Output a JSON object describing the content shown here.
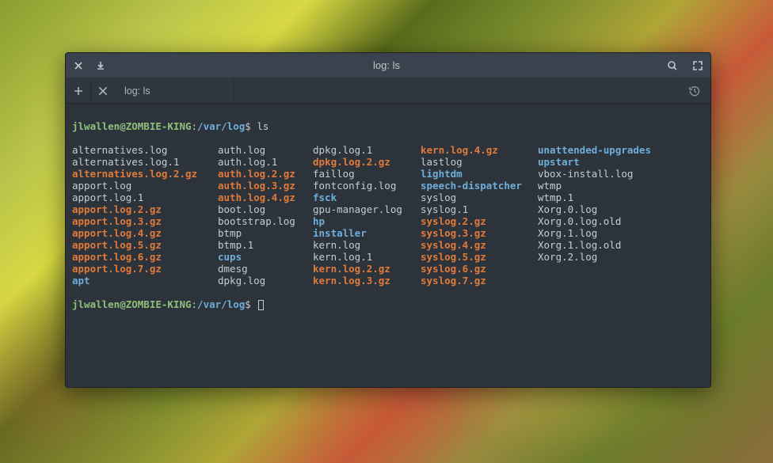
{
  "titlebar": {
    "title": "log: ls"
  },
  "tabs": [
    {
      "label": "log: ls"
    }
  ],
  "prompt": {
    "user_host": "jlwallen@ZOMBIE-KING",
    "sep": ":",
    "cwd": "/var/log",
    "dollar": "$ ",
    "command": "ls"
  },
  "file_types": {
    "plain": "regular file",
    "blue": "directory",
    "orange": "archive / compressed (.gz)"
  },
  "ls": {
    "columns": [
      [
        {
          "name": "alternatives.log",
          "type": "plain"
        },
        {
          "name": "alternatives.log.1",
          "type": "plain"
        },
        {
          "name": "alternatives.log.2.gz",
          "type": "orange"
        },
        {
          "name": "apport.log",
          "type": "plain"
        },
        {
          "name": "apport.log.1",
          "type": "plain"
        },
        {
          "name": "apport.log.2.gz",
          "type": "orange"
        },
        {
          "name": "apport.log.3.gz",
          "type": "orange"
        },
        {
          "name": "apport.log.4.gz",
          "type": "orange"
        },
        {
          "name": "apport.log.5.gz",
          "type": "orange"
        },
        {
          "name": "apport.log.6.gz",
          "type": "orange"
        },
        {
          "name": "apport.log.7.gz",
          "type": "orange"
        },
        {
          "name": "apt",
          "type": "blue"
        }
      ],
      [
        {
          "name": "auth.log",
          "type": "plain"
        },
        {
          "name": "auth.log.1",
          "type": "plain"
        },
        {
          "name": "auth.log.2.gz",
          "type": "orange"
        },
        {
          "name": "auth.log.3.gz",
          "type": "orange"
        },
        {
          "name": "auth.log.4.gz",
          "type": "orange"
        },
        {
          "name": "boot.log",
          "type": "plain"
        },
        {
          "name": "bootstrap.log",
          "type": "plain"
        },
        {
          "name": "btmp",
          "type": "plain"
        },
        {
          "name": "btmp.1",
          "type": "plain"
        },
        {
          "name": "cups",
          "type": "blue"
        },
        {
          "name": "dmesg",
          "type": "plain"
        },
        {
          "name": "dpkg.log",
          "type": "plain"
        }
      ],
      [
        {
          "name": "dpkg.log.1",
          "type": "plain"
        },
        {
          "name": "dpkg.log.2.gz",
          "type": "orange"
        },
        {
          "name": "faillog",
          "type": "plain"
        },
        {
          "name": "fontconfig.log",
          "type": "plain"
        },
        {
          "name": "fsck",
          "type": "blue"
        },
        {
          "name": "gpu-manager.log",
          "type": "plain"
        },
        {
          "name": "hp",
          "type": "blue"
        },
        {
          "name": "installer",
          "type": "blue"
        },
        {
          "name": "kern.log",
          "type": "plain"
        },
        {
          "name": "kern.log.1",
          "type": "plain"
        },
        {
          "name": "kern.log.2.gz",
          "type": "orange"
        },
        {
          "name": "kern.log.3.gz",
          "type": "orange"
        }
      ],
      [
        {
          "name": "kern.log.4.gz",
          "type": "orange"
        },
        {
          "name": "lastlog",
          "type": "plain"
        },
        {
          "name": "lightdm",
          "type": "blue"
        },
        {
          "name": "speech-dispatcher",
          "type": "blue"
        },
        {
          "name": "syslog",
          "type": "plain"
        },
        {
          "name": "syslog.1",
          "type": "plain"
        },
        {
          "name": "syslog.2.gz",
          "type": "orange"
        },
        {
          "name": "syslog.3.gz",
          "type": "orange"
        },
        {
          "name": "syslog.4.gz",
          "type": "orange"
        },
        {
          "name": "syslog.5.gz",
          "type": "orange"
        },
        {
          "name": "syslog.6.gz",
          "type": "orange"
        },
        {
          "name": "syslog.7.gz",
          "type": "orange"
        }
      ],
      [
        {
          "name": "unattended-upgrades",
          "type": "blue"
        },
        {
          "name": "upstart",
          "type": "blue"
        },
        {
          "name": "vbox-install.log",
          "type": "plain"
        },
        {
          "name": "wtmp",
          "type": "plain"
        },
        {
          "name": "wtmp.1",
          "type": "plain"
        },
        {
          "name": "Xorg.0.log",
          "type": "plain"
        },
        {
          "name": "Xorg.0.log.old",
          "type": "plain"
        },
        {
          "name": "Xorg.1.log",
          "type": "plain"
        },
        {
          "name": "Xorg.1.log.old",
          "type": "plain"
        },
        {
          "name": "Xorg.2.log",
          "type": "plain"
        }
      ]
    ]
  }
}
